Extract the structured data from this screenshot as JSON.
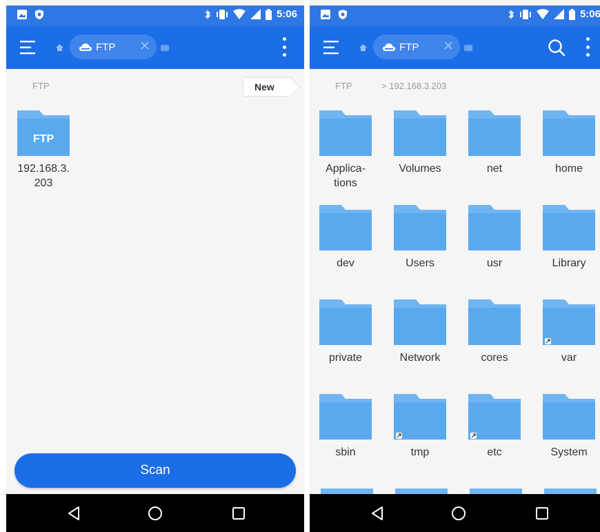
{
  "status_bar": {
    "time": "5:06"
  },
  "colors": {
    "statusbar": "#2f77e4",
    "appbar": "#1c6ee8",
    "folder": "#5aa9ee",
    "folder_tab": "#6fb5f1"
  },
  "left_screen": {
    "tab": {
      "label": "FTP"
    },
    "breadcrumb": "FTP",
    "new_button": "New",
    "server_folder": {
      "badge": "FTP",
      "name_line1": "192.168.3.",
      "name_line2": "203"
    },
    "scan_button": "Scan"
  },
  "right_screen": {
    "tab": {
      "label": "FTP"
    },
    "breadcrumb": {
      "root": "FTP",
      "path": "192.168.3.203"
    },
    "folders": [
      {
        "name": "Applica-\ntions",
        "symlink": false
      },
      {
        "name": "Volumes",
        "symlink": false
      },
      {
        "name": "net",
        "symlink": false
      },
      {
        "name": "home",
        "symlink": false
      },
      {
        "name": "dev",
        "symlink": false
      },
      {
        "name": "Users",
        "symlink": false
      },
      {
        "name": "usr",
        "symlink": false
      },
      {
        "name": "Library",
        "symlink": false
      },
      {
        "name": "private",
        "symlink": false
      },
      {
        "name": "Network",
        "symlink": false
      },
      {
        "name": "cores",
        "symlink": false
      },
      {
        "name": "var",
        "symlink": true
      },
      {
        "name": "sbin",
        "symlink": false
      },
      {
        "name": "tmp",
        "symlink": true
      },
      {
        "name": "etc",
        "symlink": true
      },
      {
        "name": "System",
        "symlink": false
      }
    ]
  },
  "icons": {
    "status_left": [
      "image-notification-icon",
      "shield-notification-icon"
    ],
    "status_right": [
      "bluetooth-icon",
      "vibrate-icon",
      "wifi-icon",
      "signal-icon",
      "battery-icon"
    ],
    "nav": [
      "back-icon",
      "home-circle-icon",
      "recents-icon"
    ]
  }
}
